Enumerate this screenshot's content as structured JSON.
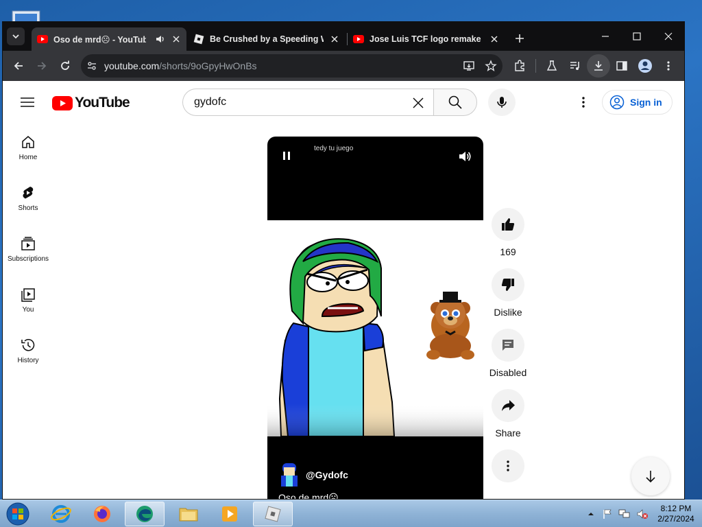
{
  "browser": {
    "tabs": [
      {
        "title": "Oso de mrd☹ - YouTube",
        "favicon": "youtube-favicon",
        "active": true,
        "audio": true
      },
      {
        "title": "Be Crushed by a Speeding Wal",
        "favicon": "roblox-favicon",
        "active": false
      },
      {
        "title": "Jose Luis TCF logo remake Is B",
        "favicon": "youtube-favicon",
        "active": false
      }
    ],
    "url_host": "youtube.com",
    "url_path": "/shorts/9oGpyHwOnBs"
  },
  "youtube": {
    "logo_text": "YouTube",
    "search_value": "gydofc",
    "sign_in_label": "Sign in",
    "sidebar": [
      {
        "label": "Home",
        "icon": "home-icon"
      },
      {
        "label": "Shorts",
        "icon": "shorts-icon"
      },
      {
        "label": "Subscriptions",
        "icon": "subscriptions-icon"
      },
      {
        "label": "You",
        "icon": "you-library-icon"
      },
      {
        "label": "History",
        "icon": "history-icon"
      }
    ],
    "short": {
      "top_text": "tedy tu juego",
      "channel": "@Gydofc",
      "caption": "Oso de mrd☹"
    },
    "actions": {
      "like_count": "169",
      "dislike_label": "Dislike",
      "comments_label": "Disabled",
      "share_label": "Share"
    }
  },
  "taskbar": {
    "time": "8:12 PM",
    "date": "2/27/2024"
  },
  "colors": {
    "yt_red": "#ff0000",
    "signin_blue": "#065fd4"
  }
}
